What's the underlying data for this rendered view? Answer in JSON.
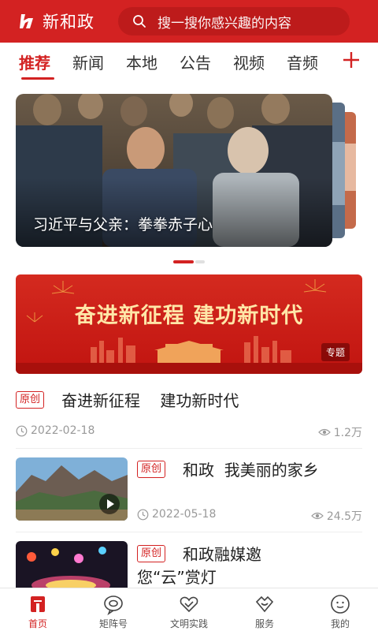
{
  "header": {
    "app_name": "新和政",
    "search_placeholder": "搜一搜你感兴趣的内容"
  },
  "tabs": [
    {
      "label": "推荐",
      "active": true
    },
    {
      "label": "新闻"
    },
    {
      "label": "本地"
    },
    {
      "label": "公告"
    },
    {
      "label": "视频"
    },
    {
      "label": "音频"
    }
  ],
  "carousel": {
    "caption": "习近平与父亲：拳拳赤子心"
  },
  "banner": {
    "title": "奋进新征程  建功新时代",
    "tag": "专题"
  },
  "articles": [
    {
      "badge": "原创",
      "title": "奋进新征程    建功新时代",
      "date": "2022-02-18",
      "views": "1.2万"
    },
    {
      "badge": "原创",
      "title": "和政  我美丽的家乡",
      "date": "2022-05-18",
      "views": "24.5万"
    },
    {
      "badge": "原创",
      "title_line1": "和政融媒邀",
      "title_line2": "您“云”赏灯"
    }
  ],
  "bottom_nav": [
    {
      "label": "首页",
      "icon": "home-icon",
      "active": true
    },
    {
      "label": "矩阵号",
      "icon": "matrix-icon"
    },
    {
      "label": "文明实践",
      "icon": "heart-icon"
    },
    {
      "label": "服务",
      "icon": "service-icon"
    },
    {
      "label": "我的",
      "icon": "profile-icon"
    }
  ],
  "colors": {
    "brand_red": "#d32222",
    "banner_text": "#ffe7a8",
    "muted_text": "#999999"
  }
}
